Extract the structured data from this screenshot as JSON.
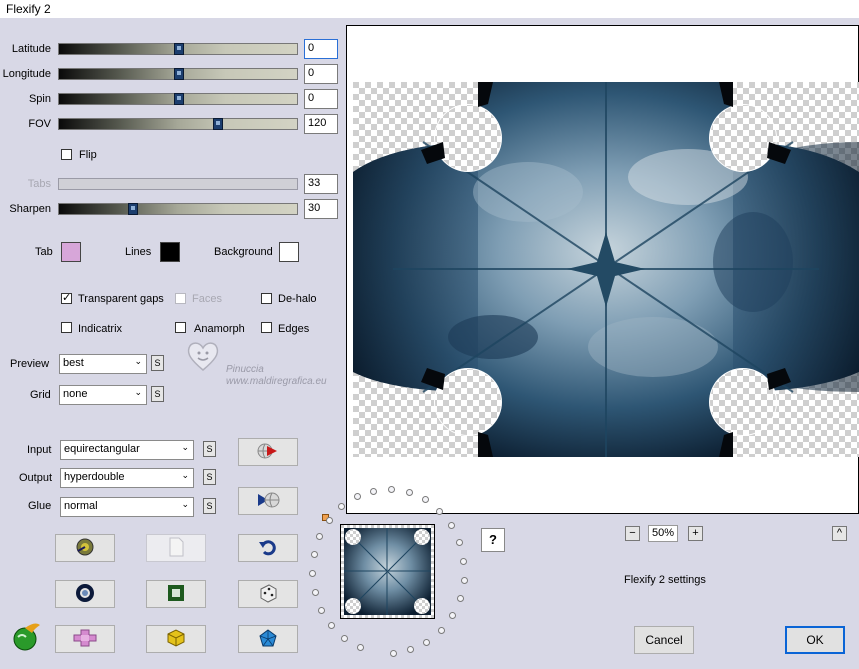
{
  "window": {
    "title": "Flexify 2"
  },
  "sliders": [
    {
      "name": "latitude",
      "label": "Latitude",
      "value": "0",
      "level": 0.5,
      "disabled": false,
      "focus": true
    },
    {
      "name": "longitude",
      "label": "Longitude",
      "value": "0",
      "level": 0.5,
      "disabled": false,
      "focus": false
    },
    {
      "name": "spin",
      "label": "Spin",
      "value": "0",
      "level": 0.5,
      "disabled": false,
      "focus": false
    },
    {
      "name": "fov",
      "label": "FOV",
      "value": "120",
      "level": 0.67,
      "disabled": false,
      "focus": false
    },
    {
      "name": "tabs",
      "label": "Tabs",
      "value": "33",
      "level": null,
      "disabled": true,
      "focus": false
    },
    {
      "name": "sharpen",
      "label": "Sharpen",
      "value": "30",
      "level": 0.3,
      "disabled": false,
      "focus": false
    }
  ],
  "flip": {
    "label": "Flip",
    "checked": false
  },
  "colors": {
    "tab_label": "Tab",
    "tab_color": "#d7a6d9",
    "lines_label": "Lines",
    "lines_color": "#000000",
    "background_label": "Background",
    "background_color": "#ffffff"
  },
  "options": {
    "transparent_gaps": {
      "label": "Transparent gaps",
      "checked": true
    },
    "faces": {
      "label": "Faces",
      "checked": false,
      "disabled": true
    },
    "dehalo": {
      "label": "De-halo",
      "checked": false
    },
    "indicatrix": {
      "label": "Indicatrix",
      "checked": false
    },
    "anamorph": {
      "label": "Anamorph",
      "checked": false
    },
    "edges": {
      "label": "Edges",
      "checked": false
    }
  },
  "preview": {
    "label": "Preview",
    "value": "best"
  },
  "grid": {
    "label": "Grid",
    "value": "none"
  },
  "input": {
    "label": "Input",
    "value": "equirectangular"
  },
  "output": {
    "label": "Output",
    "value": "hyperdouble"
  },
  "glue": {
    "label": "Glue",
    "value": "normal"
  },
  "s_label": "S",
  "watermark": {
    "name": "Pinuccia",
    "site": "www.maldiregrafica.eu"
  },
  "zoom": {
    "minus": "−",
    "value": "50%",
    "plus": "+"
  },
  "help_label": "?",
  "collapse_label": "^",
  "settings_label": "Flexify 2 settings",
  "buttons": {
    "cancel": "Cancel",
    "ok": "OK"
  },
  "icons": [
    "globe-play-icon",
    "globe-forward-icon",
    "open-file-icon",
    "blank-page-icon",
    "undo-icon",
    "ring-icon",
    "frame-icon",
    "dice-icon",
    "flexify-logo-icon",
    "puzzle-icon",
    "cube-icon",
    "pentagon-icon"
  ]
}
